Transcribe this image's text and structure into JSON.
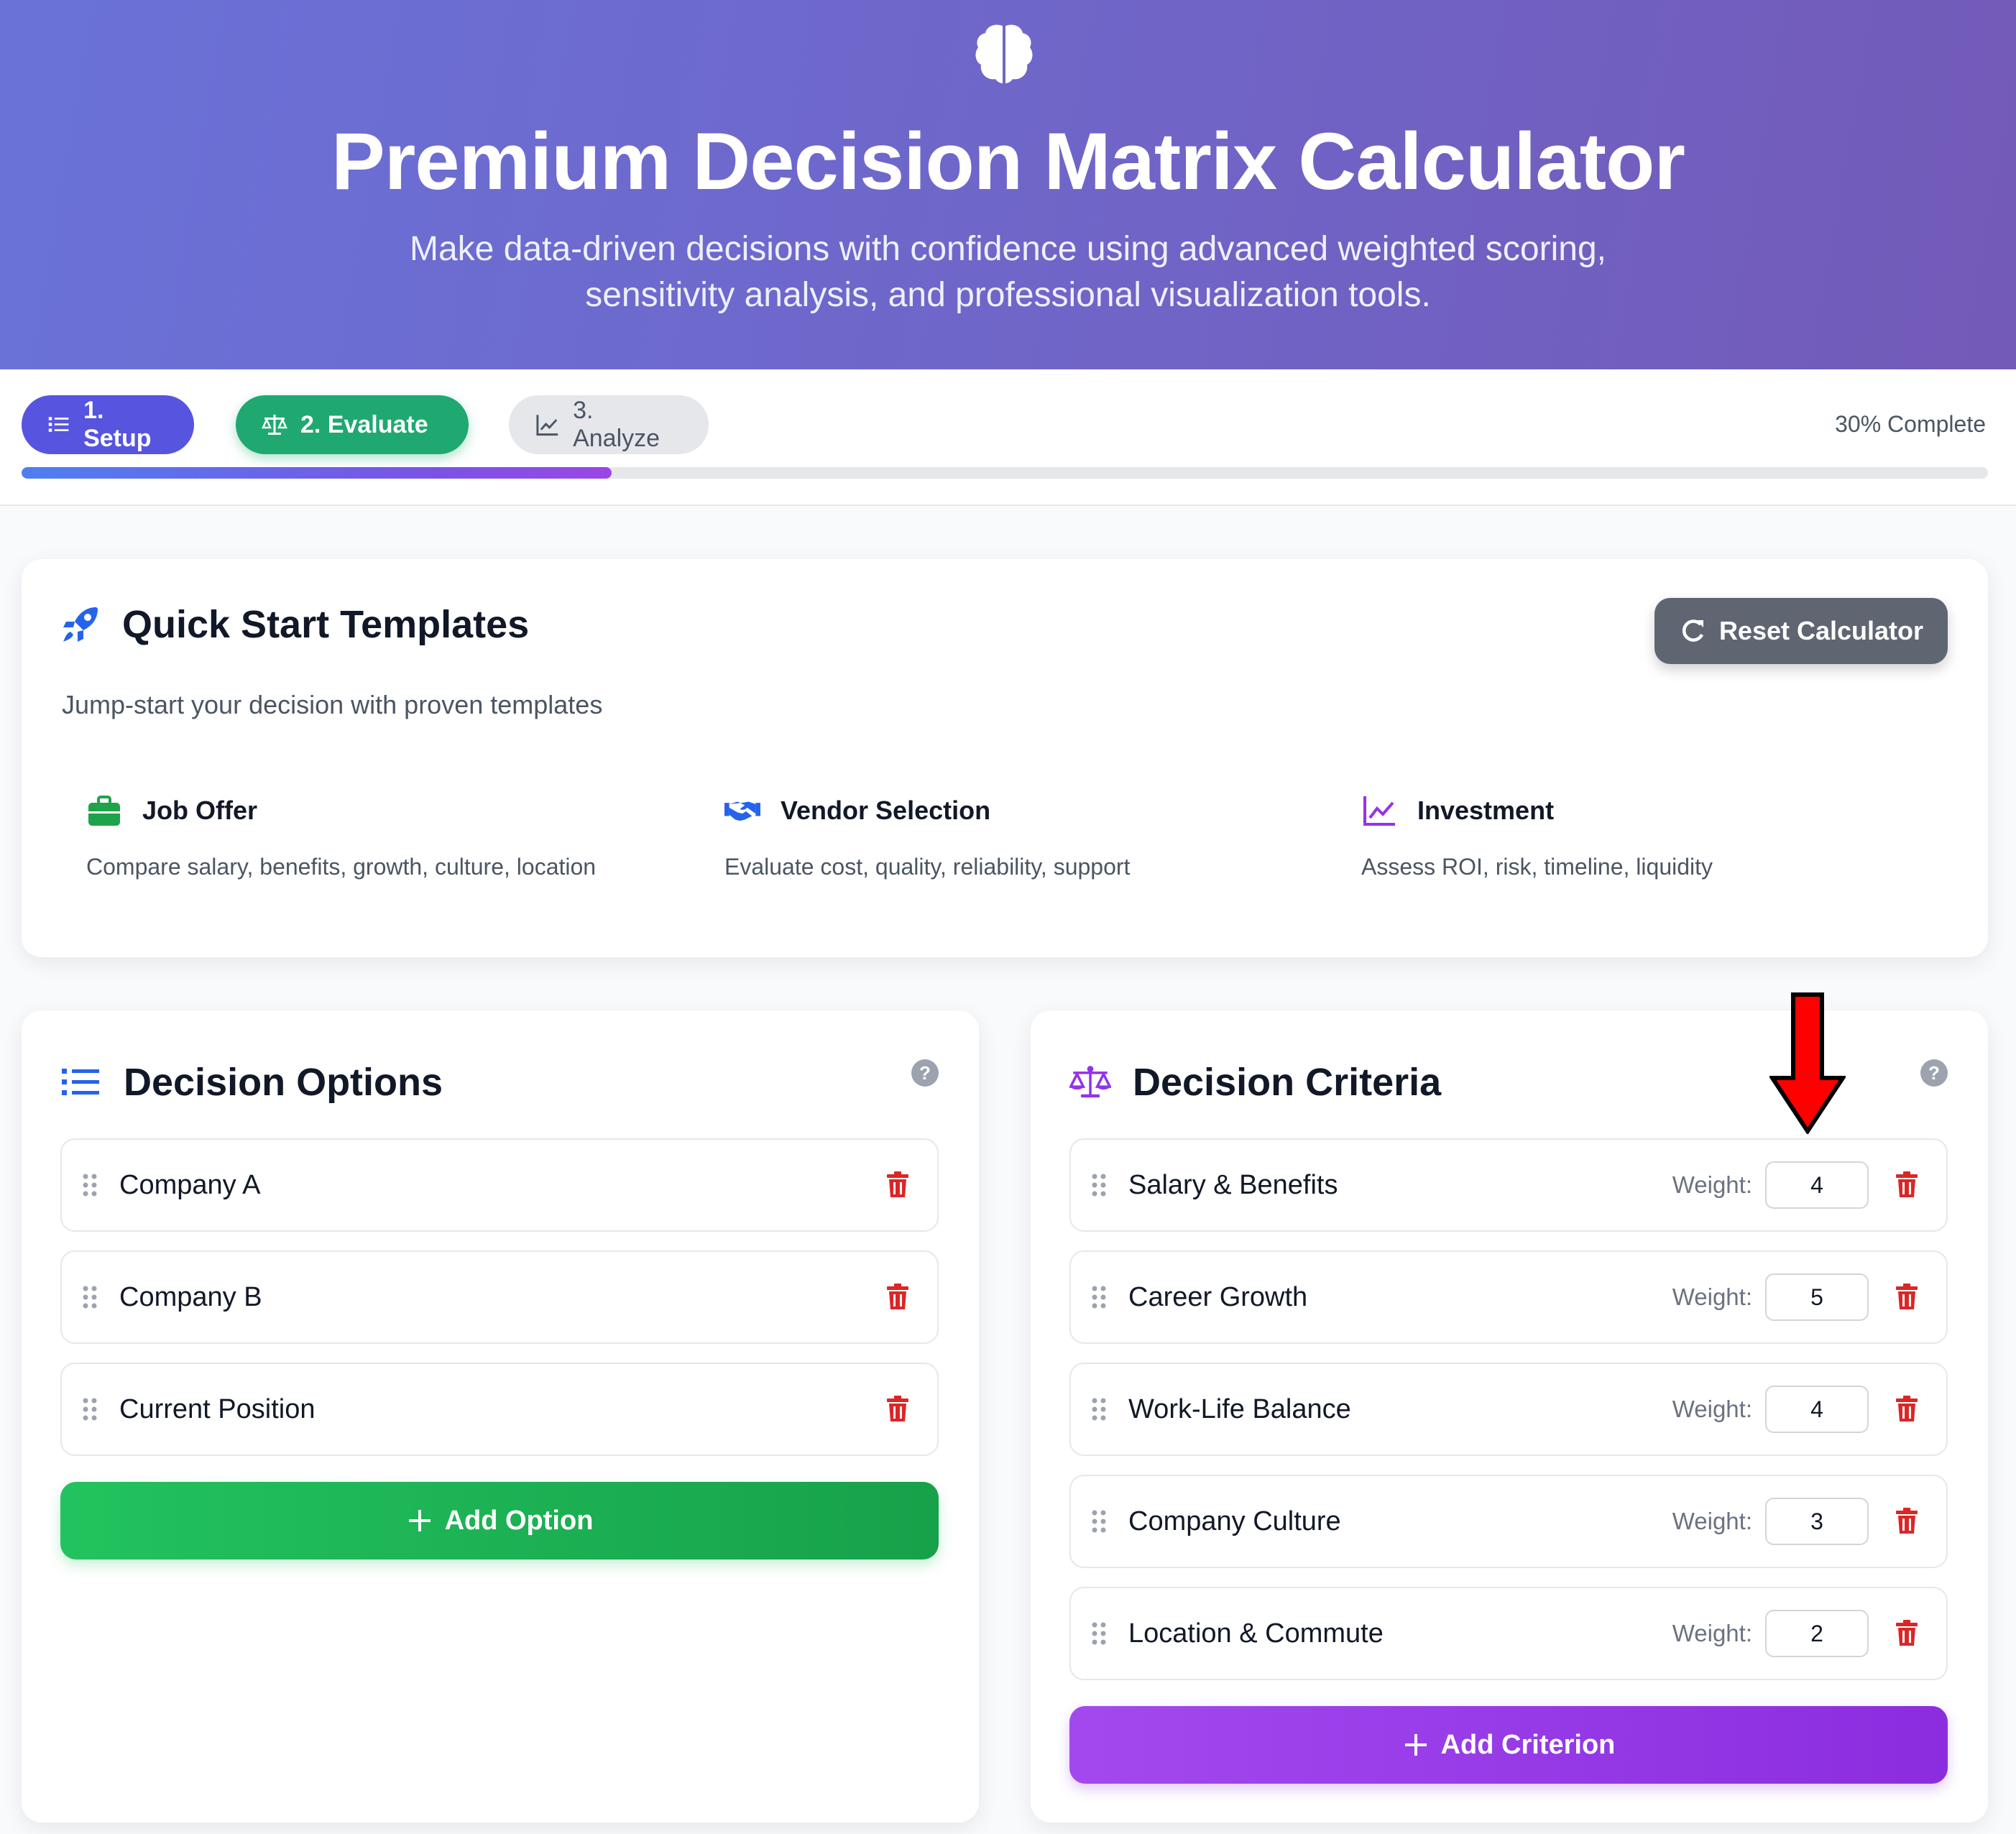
{
  "hero": {
    "title": "Premium Decision Matrix Calculator",
    "subtitle": "Make data-driven decisions with confidence using advanced weighted scoring, sensitivity analysis, and professional visualization tools.",
    "icon": "brain-icon"
  },
  "steps": [
    {
      "label": "1. Setup",
      "icon": "list-icon",
      "color": "#5754e0"
    },
    {
      "label": "2. Evaluate",
      "icon": "balance-scale-icon",
      "color": "#1fa971"
    },
    {
      "label": "3. Analyze",
      "icon": "chart-line-icon",
      "color": "#e5e7eb"
    }
  ],
  "progress": {
    "text": "30% Complete",
    "value": 0.3
  },
  "templates": {
    "title": "Quick Start Templates",
    "subtitle": "Jump-start your decision with proven templates",
    "reset_label": "Reset Calculator",
    "items": [
      {
        "name": "Job Offer",
        "description": "Compare salary, benefits, growth, culture, location",
        "icon": "briefcase-icon",
        "color": "#1fa34a"
      },
      {
        "name": "Vendor Selection",
        "description": "Evaluate cost, quality, reliability, support",
        "icon": "handshake-icon",
        "color": "#2563eb"
      },
      {
        "name": "Investment",
        "description": "Assess ROI, risk, timeline, liquidity",
        "icon": "chart-line-icon",
        "color": "#9333ea"
      }
    ]
  },
  "options": {
    "title": "Decision Options",
    "items": [
      "Company A",
      "Company B",
      "Current Position"
    ],
    "add_label": "Add Option"
  },
  "criteria": {
    "title": "Decision Criteria",
    "weight_label": "Weight:",
    "items": [
      {
        "name": "Salary & Benefits",
        "weight": "4"
      },
      {
        "name": "Career Growth",
        "weight": "5"
      },
      {
        "name": "Work-Life Balance",
        "weight": "4"
      },
      {
        "name": "Company Culture",
        "weight": "3"
      },
      {
        "name": "Location & Commute",
        "weight": "2"
      }
    ],
    "add_label": "Add Criterion"
  },
  "help_glyph": "?",
  "colors": {
    "accent": "#5754e0",
    "danger": "#dc2626",
    "annotation_arrow": "#ff0000"
  }
}
